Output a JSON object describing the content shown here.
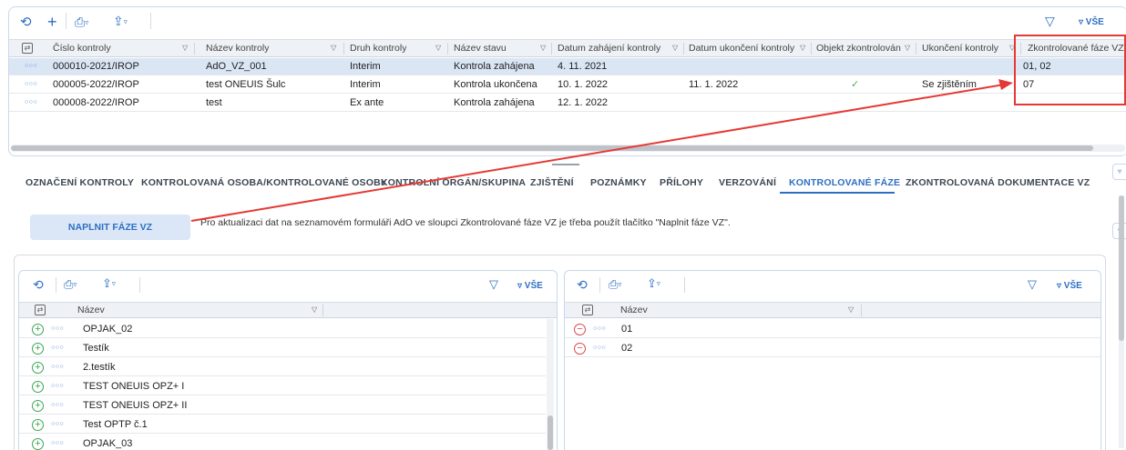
{
  "top_toolbar": {
    "refresh_icon": "refresh-icon",
    "add_icon": "plus-icon",
    "print_icon": "print-icon",
    "export_icon": "export-icon",
    "filter_icon": "filter-icon",
    "all_label": "▿ VŠE"
  },
  "main_grid": {
    "columns": [
      "Číslo kontroly",
      "Název kontroly",
      "Druh kontroly",
      "Název stavu",
      "Datum zahájení kontroly",
      "Datum ukončení kontroly",
      "Objekt zkontrolován",
      "Ukončení kontroly",
      "Zkontrolované fáze VZ"
    ],
    "rows": [
      {
        "cislo": "000010-2021/IROP",
        "nazev": "AdO_VZ_001",
        "druh": "Interim",
        "stav": "Kontrola zahájena",
        "zahajeni": "4. 11. 2021",
        "ukonceni": "",
        "objekt": "",
        "ukonceni_kontroly": "",
        "faze": "01, 02"
      },
      {
        "cislo": "000005-2022/IROP",
        "nazev": "test ONEUIS Šulc",
        "druh": "Interim",
        "stav": "Kontrola ukončena",
        "zahajeni": "10. 1. 2022",
        "ukonceni": "11. 1. 2022",
        "objekt": "✓",
        "ukonceni_kontroly": "Se zjištěním",
        "faze": "07"
      },
      {
        "cislo": "000008-2022/IROP",
        "nazev": "test",
        "druh": "Ex ante",
        "stav": "Kontrola zahájena",
        "zahajeni": "12. 1. 2022",
        "ukonceni": "",
        "objekt": "",
        "ukonceni_kontroly": "",
        "faze": ""
      }
    ]
  },
  "tabs": [
    "OZNAČENÍ KONTROLY",
    "KONTROLOVANÁ OSOBA/KONTROLOVANÉ OSOBY",
    "KONTROLNÍ ORGÁN/SKUPINA",
    "ZJIŠTĚNÍ",
    "POZNÁMKY",
    "PŘÍLOHY",
    "VERZOVÁNÍ",
    "KONTROLOVANÉ FÁZE",
    "ZKONTROLOVANÁ DOKUMENTACE VZ"
  ],
  "active_tab": "KONTROLOVANÉ FÁZE",
  "fill_button_label": "NAPLNIT FÁZE VZ",
  "info_text": "Pro aktualizaci dat na seznamovém formuláři AdO ve sloupci Zkontrolované fáze VZ je třeba použít tlačítko \"Naplnit fáze VZ\".",
  "left_grid": {
    "all_label": "▿ VŠE",
    "column": "Název",
    "rows": [
      "OPJAK_02",
      "Testík",
      "2.testík",
      "TEST ONEUIS OPZ+ I",
      "TEST ONEUIS OPZ+ II",
      "Test OPTP č.1",
      "OPJAK_03"
    ]
  },
  "right_grid": {
    "all_label": "▿ VŠE",
    "column": "Název",
    "rows": [
      "01",
      "02"
    ]
  },
  "colors": {
    "accent": "#2d6fc4",
    "selected_row": "#dbe6f5",
    "highlight_red": "#e53935",
    "add_green": "#3aa653",
    "remove_red": "#d94b4b"
  }
}
